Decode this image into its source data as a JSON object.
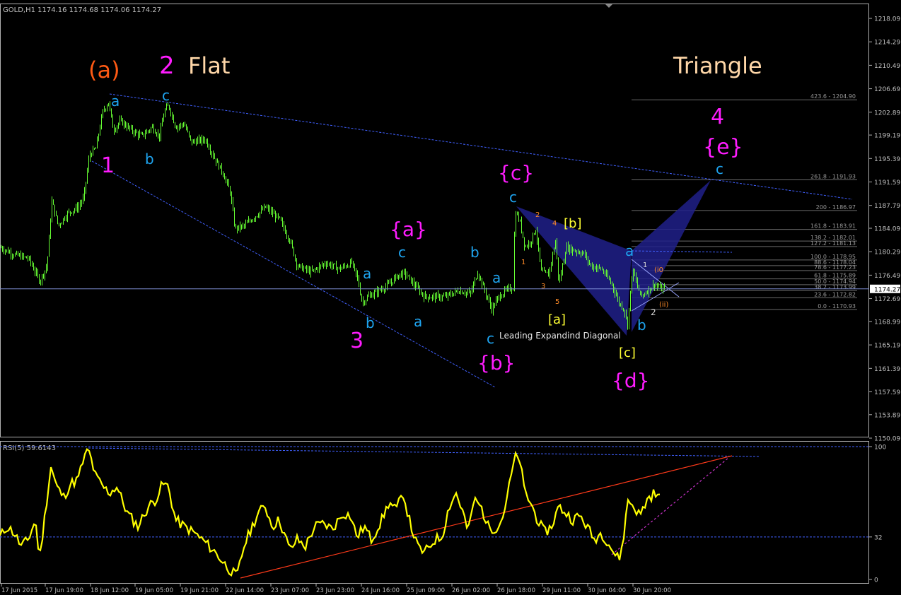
{
  "header": {
    "symbol_line": "GOLD,H1  1174.16 1174.68 1174.06 1174.27",
    "rsi_line": "RSI(5) 59.6143"
  },
  "colors": {
    "background": "#000000",
    "candle": "#66ff33",
    "grid_text": "#c0c0c0",
    "trend_blue": "#4060ff",
    "rsi": "#ffff00",
    "rsi_trend": "#ff3a1a",
    "rsi_trend_dashed": "#cc33cc",
    "triangle_fill": "#20208a",
    "wave_cyan": "#1ea4f0",
    "wave_magenta": "#ff1cff",
    "wave_orange": "#ff5a14",
    "wave_yellow": "#ffff33",
    "wave_peach": "#ffd7a8",
    "fib_small_orange": "#ff8c28",
    "current_price_line": "#7f8fd6"
  },
  "chart_data": [
    {
      "type": "candlestick",
      "symbol": "GOLD",
      "timeframe": "H1",
      "y_axis_ticks": [
        1218.09,
        1214.29,
        1210.49,
        1206.69,
        1202.89,
        1199.19,
        1195.39,
        1191.59,
        1187.79,
        1184.09,
        1180.29,
        1176.49,
        1172.69,
        1168.99,
        1165.19,
        1161.39,
        1157.59,
        1153.89,
        1150.09
      ],
      "ylim": [
        1150.09,
        1219.5
      ],
      "current_price": "1174.27",
      "x_axis_ticks": [
        "17 Jun 2015",
        "17 Jun 19:00",
        "18 Jun 12:00",
        "19 Jun 05:00",
        "19 Jun 21:00",
        "22 Jun 14:00",
        "23 Jun 07:00",
        "23 Jun 23:00",
        "24 Jun 16:00",
        "25 Jun 09:00",
        "26 Jun 02:00",
        "26 Jun 18:00",
        "29 Jun 11:00",
        "30 Jun 04:00",
        "30 Jun 20:00"
      ],
      "price_path": [
        [
          0,
          1181.0
        ],
        [
          20,
          1179.8
        ],
        [
          40,
          1179.2
        ],
        [
          56,
          1175.5
        ],
        [
          66,
          1178.0
        ],
        [
          73,
          1188.5
        ],
        [
          82,
          1184.5
        ],
        [
          95,
          1186.5
        ],
        [
          110,
          1187.5
        ],
        [
          118,
          1189.0
        ],
        [
          126,
          1196.0
        ],
        [
          135,
          1197.0
        ],
        [
          145,
          1203.0
        ],
        [
          153,
          1204.5
        ],
        [
          160,
          1200.0
        ],
        [
          170,
          1201.5
        ],
        [
          185,
          1200.0
        ],
        [
          200,
          1199.0
        ],
        [
          215,
          1200.5
        ],
        [
          225,
          1199.0
        ],
        [
          232,
          1203.0
        ],
        [
          238,
          1204.0
        ],
        [
          248,
          1200.5
        ],
        [
          260,
          1201.0
        ],
        [
          270,
          1198.0
        ],
        [
          290,
          1198.5
        ],
        [
          305,
          1195.0
        ],
        [
          315,
          1193.0
        ],
        [
          325,
          1190.0
        ],
        [
          332,
          1184.0
        ],
        [
          345,
          1184.5
        ],
        [
          360,
          1186.0
        ],
        [
          375,
          1187.5
        ],
        [
          395,
          1185.5
        ],
        [
          410,
          1182.0
        ],
        [
          420,
          1178.0
        ],
        [
          440,
          1177.0
        ],
        [
          460,
          1178.5
        ],
        [
          480,
          1177.5
        ],
        [
          497,
          1178.5
        ],
        [
          505,
          1176.0
        ],
        [
          512,
          1172.0
        ],
        [
          520,
          1173.0
        ],
        [
          535,
          1174.0
        ],
        [
          550,
          1175.0
        ],
        [
          562,
          1176.5
        ],
        [
          572,
          1176.8
        ],
        [
          585,
          1175.0
        ],
        [
          600,
          1173.0
        ],
        [
          615,
          1173.0
        ],
        [
          630,
          1173.0
        ],
        [
          648,
          1174.0
        ],
        [
          665,
          1173.5
        ],
        [
          675,
          1177.0
        ],
        [
          685,
          1174.0
        ],
        [
          695,
          1171.0
        ],
        [
          705,
          1173.0
        ],
        [
          715,
          1174.0
        ],
        [
          725,
          1174.5
        ],
        [
          728,
          1187.0
        ],
        [
          735,
          1185.0
        ],
        [
          742,
          1181.0
        ],
        [
          750,
          1182.0
        ],
        [
          757,
          1184.0
        ],
        [
          765,
          1177.0
        ],
        [
          775,
          1176.5
        ],
        [
          785,
          1182.0
        ],
        [
          790,
          1175.0
        ],
        [
          800,
          1181.0
        ],
        [
          812,
          1180.5
        ],
        [
          825,
          1180.0
        ],
        [
          835,
          1178.0
        ],
        [
          850,
          1177.5
        ],
        [
          865,
          1175.0
        ],
        [
          875,
          1172.0
        ],
        [
          882,
          1171.0
        ],
        [
          887,
          1168.5
        ],
        [
          894,
          1177.5
        ],
        [
          900,
          1175.0
        ],
        [
          906,
          1173.0
        ],
        [
          915,
          1174.0
        ],
        [
          925,
          1175.0
        ],
        [
          935,
          1174.2
        ],
        [
          940,
          1174.27
        ]
      ],
      "fibonacci_levels": [
        {
          "ratio": "423.6",
          "price": "1204.90"
        },
        {
          "ratio": "261.8",
          "price": "1191.93"
        },
        {
          "ratio": "200",
          "price": "1186.97"
        },
        {
          "ratio": "161.8",
          "price": "1183.91"
        },
        {
          "ratio": "138.2",
          "price": "1182.01"
        },
        {
          "ratio": "127.2",
          "price": "1181.13"
        },
        {
          "ratio": "100.0",
          "price": "1178.95"
        },
        {
          "ratio": "88.6",
          "price": "1178.04"
        },
        {
          "ratio": "78.6",
          "price": "1177.23"
        },
        {
          "ratio": "61.8",
          "price": "1175.89"
        },
        {
          "ratio": "50.0",
          "price": "1174.94"
        },
        {
          "ratio": "38.2",
          "price": "1173.99"
        },
        {
          "ratio": "23.6",
          "price": "1172.82"
        },
        {
          "ratio": "0.0",
          "price": "1170.93"
        }
      ],
      "annotations": {
        "titles": [
          "(a)",
          "2",
          "Flat",
          "Triangle",
          "4",
          "{e}"
        ],
        "waves": [
          "1",
          "a",
          "c",
          "b",
          "3",
          "{a}",
          "a",
          "b",
          "c",
          "a",
          "b",
          "a",
          "c",
          "{b}",
          "{c}",
          "c",
          "1",
          "2",
          "3",
          "4",
          "5",
          "[a]",
          "[b]",
          "[c]",
          "{d}",
          "a",
          "b",
          "1",
          "2",
          "(i0",
          "(ii)",
          "c"
        ],
        "pattern_label": "Leading Expandind Diagonal"
      }
    },
    {
      "type": "line",
      "name": "RSI(5)",
      "value": "59.6143",
      "y_axis_ticks": [
        "100",
        "32",
        "0"
      ],
      "ylim": [
        0,
        100
      ],
      "levels": [
        100,
        32
      ],
      "rsi_path": [
        [
          0,
          32
        ],
        [
          10,
          40
        ],
        [
          20,
          35
        ],
        [
          30,
          25
        ],
        [
          40,
          30
        ],
        [
          50,
          45
        ],
        [
          56,
          15
        ],
        [
          65,
          55
        ],
        [
          72,
          85
        ],
        [
          80,
          70
        ],
        [
          90,
          62
        ],
        [
          100,
          72
        ],
        [
          110,
          75
        ],
        [
          118,
          90
        ],
        [
          125,
          98
        ],
        [
          135,
          78
        ],
        [
          145,
          70
        ],
        [
          155,
          65
        ],
        [
          165,
          70
        ],
        [
          180,
          50
        ],
        [
          195,
          40
        ],
        [
          210,
          55
        ],
        [
          220,
          60
        ],
        [
          230,
          72
        ],
        [
          238,
          70
        ],
        [
          248,
          45
        ],
        [
          260,
          40
        ],
        [
          275,
          35
        ],
        [
          290,
          28
        ],
        [
          305,
          20
        ],
        [
          320,
          10
        ],
        [
          335,
          2
        ],
        [
          345,
          25
        ],
        [
          355,
          38
        ],
        [
          365,
          50
        ],
        [
          375,
          55
        ],
        [
          385,
          40
        ],
        [
          395,
          45
        ],
        [
          410,
          22
        ],
        [
          420,
          30
        ],
        [
          432,
          25
        ],
        [
          445,
          40
        ],
        [
          458,
          42
        ],
        [
          470,
          38
        ],
        [
          485,
          50
        ],
        [
          495,
          48
        ],
        [
          505,
          32
        ],
        [
          515,
          40
        ],
        [
          525,
          30
        ],
        [
          540,
          45
        ],
        [
          550,
          58
        ],
        [
          560,
          52
        ],
        [
          570,
          65
        ],
        [
          580,
          42
        ],
        [
          590,
          25
        ],
        [
          600,
          20
        ],
        [
          615,
          30
        ],
        [
          625,
          32
        ],
        [
          635,
          55
        ],
        [
          645,
          65
        ],
        [
          655,
          50
        ],
        [
          662,
          35
        ],
        [
          670,
          60
        ],
        [
          680,
          55
        ],
        [
          690,
          40
        ],
        [
          700,
          38
        ],
        [
          710,
          45
        ],
        [
          720,
          70
        ],
        [
          728,
          92
        ],
        [
          735,
          90
        ],
        [
          742,
          65
        ],
        [
          750,
          58
        ],
        [
          760,
          45
        ],
        [
          770,
          35
        ],
        [
          780,
          40
        ],
        [
          790,
          55
        ],
        [
          800,
          50
        ],
        [
          810,
          45
        ],
        [
          820,
          48
        ],
        [
          830,
          40
        ],
        [
          840,
          30
        ],
        [
          850,
          35
        ],
        [
          860,
          28
        ],
        [
          868,
          20
        ],
        [
          875,
          15
        ],
        [
          880,
          25
        ],
        [
          888,
          60
        ],
        [
          896,
          55
        ],
        [
          905,
          48
        ],
        [
          915,
          60
        ],
        [
          925,
          65
        ],
        [
          935,
          60
        ]
      ]
    }
  ]
}
